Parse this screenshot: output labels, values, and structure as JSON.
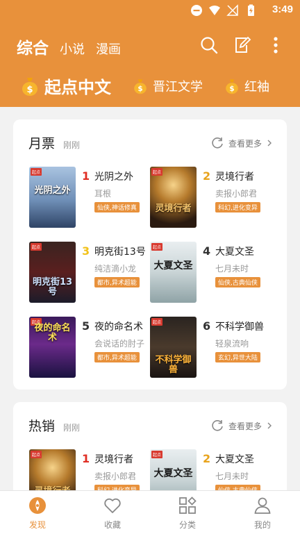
{
  "status_bar": {
    "time": "3:49"
  },
  "top_tabs": {
    "main": "综合",
    "novel": "小说",
    "comic": "漫画"
  },
  "sources": [
    {
      "label": "起点中文"
    },
    {
      "label": "晋江文学"
    },
    {
      "label": "红袖"
    }
  ],
  "sections": [
    {
      "title": "月票",
      "time": "刚刚",
      "more": "查看更多",
      "books": [
        {
          "rank": "1",
          "name": "光阴之外",
          "author": "耳根",
          "tags": "仙侠,神话修真",
          "cover_title": "光阴之外",
          "rank_color": "#e02e24"
        },
        {
          "rank": "2",
          "name": "灵境行者",
          "author": "卖报小郎君",
          "tags": "科幻,进化变异",
          "cover_title": "灵境行者",
          "rank_color": "#e8a31c"
        },
        {
          "rank": "3",
          "name": "明克街13号",
          "author": "纯洁滴小龙",
          "tags": "都市,异术超能",
          "cover_title": "明克街13号",
          "rank_color": "#f2c21a"
        },
        {
          "rank": "4",
          "name": "大夏文圣",
          "author": "七月未时",
          "tags": "仙侠,古典仙侠",
          "cover_title": "大夏文圣",
          "rank_color": "#333333"
        },
        {
          "rank": "5",
          "name": "夜的命名术",
          "author": "会说话的肘子",
          "tags": "都市,异术超能",
          "cover_title": "夜的命名术",
          "rank_color": "#333333"
        },
        {
          "rank": "6",
          "name": "不科学御兽",
          "author": "轻泉流响",
          "tags": "玄幻,异世大陆",
          "cover_title": "不科学御兽",
          "rank_color": "#333333"
        }
      ]
    },
    {
      "title": "热销",
      "time": "刚刚",
      "more": "查看更多",
      "books": [
        {
          "rank": "1",
          "name": "灵境行者",
          "author": "卖报小郎君",
          "tags": "科幻,进化变异",
          "cover_title": "灵境行者",
          "rank_color": "#e02e24"
        },
        {
          "rank": "2",
          "name": "大夏文圣",
          "author": "七月未时",
          "tags": "仙侠,古典仙侠",
          "cover_title": "大夏文圣",
          "rank_color": "#e8a31c"
        }
      ]
    }
  ],
  "tab_bar": {
    "discover": "发现",
    "favorites": "收藏",
    "category": "分类",
    "mine": "我的"
  },
  "colors": {
    "accent": "#e8913b",
    "background": "#f2f2f2"
  }
}
